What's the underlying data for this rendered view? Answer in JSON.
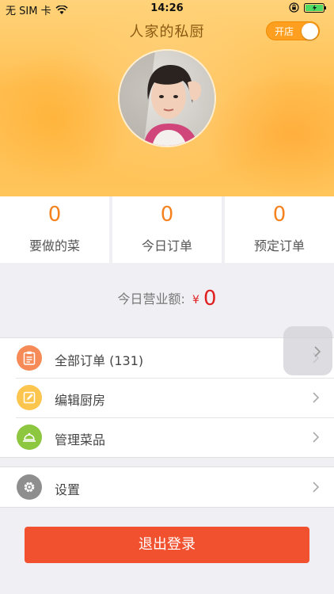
{
  "status_bar": {
    "carrier": "无 SIM 卡",
    "time": "14:26"
  },
  "header": {
    "title": "人家的私厨",
    "toggle_label": "开店"
  },
  "stats": [
    {
      "value": "0",
      "label": "要做的菜"
    },
    {
      "value": "0",
      "label": "今日订单"
    },
    {
      "value": "0",
      "label": "预定订单"
    }
  ],
  "revenue": {
    "label": "今日营业额:",
    "currency": "¥",
    "amount": "0"
  },
  "menu": {
    "items": [
      {
        "label": "全部订单 (131)",
        "icon": "clipboard-icon",
        "color": "#f68b57"
      },
      {
        "label": "编辑厨房",
        "icon": "edit-icon",
        "color": "#fcc54d"
      },
      {
        "label": "管理菜品",
        "icon": "cloche-icon",
        "color": "#8dc63f"
      }
    ],
    "settings": {
      "label": "设置",
      "icon": "gear-icon",
      "color": "#8e8e8e"
    }
  },
  "logout_label": "退出登录",
  "colors": {
    "accent": "#f5821f",
    "logout": "#f2512f",
    "revenue": "#e02020"
  }
}
